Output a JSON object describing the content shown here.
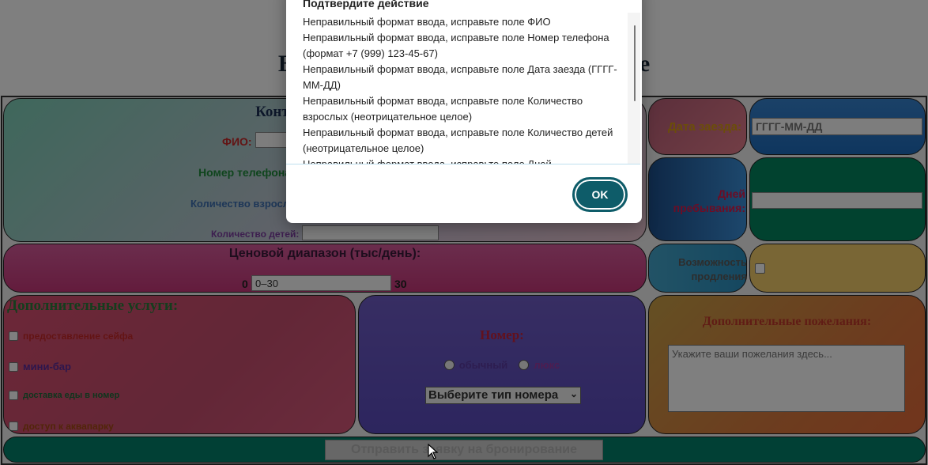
{
  "page": {
    "title": "Бронирование номера в гостинице"
  },
  "contacts": {
    "title": "Контактные данные",
    "fio_label": "ФИО:",
    "phone_label": "Номер телефона:",
    "adults_label": "Количество взрослых:",
    "children_label": "Количество детей:"
  },
  "price": {
    "title": "Ценовой диапазон (тыс/день):",
    "min": "0",
    "max": "30",
    "range_value": "0–30"
  },
  "arrival": {
    "label": "Дата заезда:",
    "placeholder": "ГГГГ-ММ-ДД"
  },
  "stay": {
    "label": "Дней пребывания:"
  },
  "extension": {
    "label": "Возможность продления"
  },
  "services": {
    "title": "Дополнительные услуги:",
    "items": [
      {
        "label": "предоставление сейфа",
        "color": "#c62828"
      },
      {
        "label": "мини-бар",
        "color": "#5b2c9a"
      },
      {
        "label": "доставка еды в номер",
        "color": "#1e6b3a"
      },
      {
        "label": "доступ к аквапарку",
        "color": "#a34a12"
      }
    ]
  },
  "room": {
    "title": "Номер:",
    "option_regular": "обычный",
    "option_lux": "люкс",
    "select_value": "Выберите тип номера"
  },
  "wishes": {
    "title": "Дополнительные пожелания:",
    "placeholder": "Укажите ваши пожелания здесь..."
  },
  "submit": {
    "label": "Отправить заявку на бронирование"
  },
  "dialog": {
    "title": "Подтвердите действие",
    "messages": [
      "Неправильный формат ввода, исправьте поле ФИО",
      "Неправильный формат ввода, исправьте поле Номер телефона (формат +7 (999) 123-45-67)",
      "Неправильный формат ввода, исправьте поле Дата заезда (ГГГГ-ММ-ДД)",
      "Неправильный формат ввода, исправьте поле Количество взрослых (неотрицательное целое)",
      "Неправильный формат ввода, исправьте поле Количество детей (неотрицательное целое)",
      "Неправильный формат ввода, исправьте поле Дней"
    ],
    "ok_label": "OK"
  },
  "colors": {
    "overlay": "rgba(0,0,0,0.5)",
    "ok_button": "#0e5c69",
    "submit_bar": "#02806a"
  }
}
